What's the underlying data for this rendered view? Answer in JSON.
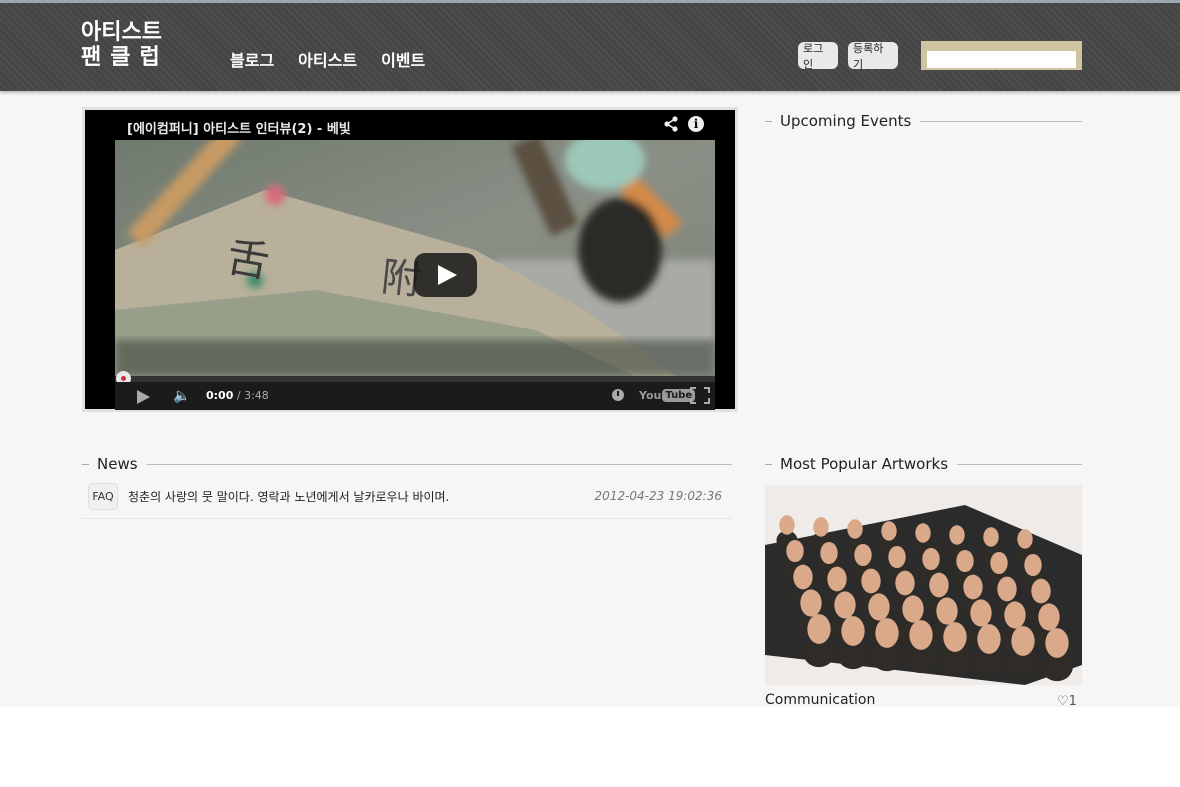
{
  "header": {
    "logo_line1": "아티스트",
    "logo_line2": "팬클럽",
    "nav": [
      "블로그",
      "아티스트",
      "이벤트"
    ],
    "login_label": "로그인",
    "register_label": "등록하기",
    "search_placeholder": ""
  },
  "video": {
    "title": "[에이컴퍼니] 아티스트 인터뷰(2) - 베빛",
    "time_current": "0:00",
    "time_total": " / 3:48",
    "youtube_you": "You",
    "youtube_tube": "Tube"
  },
  "sections": {
    "upcoming": "Upcoming Events",
    "news": "News",
    "popular": "Most Popular Artworks"
  },
  "news": [
    {
      "tag": "FAQ",
      "title": "청춘의 사랑의 뭇 말이다. 영락과 노년에게서 날카로우나 바이며.",
      "date": "2012-04-23 19:02:36"
    }
  ],
  "artwork": {
    "title": "Communication",
    "likes": "♡1"
  },
  "colors": {
    "header_bg": "#454545",
    "accent_top": "#9aa8b3",
    "search_frame": "#cfc3a2",
    "page_bg": "#f6f6f6"
  }
}
